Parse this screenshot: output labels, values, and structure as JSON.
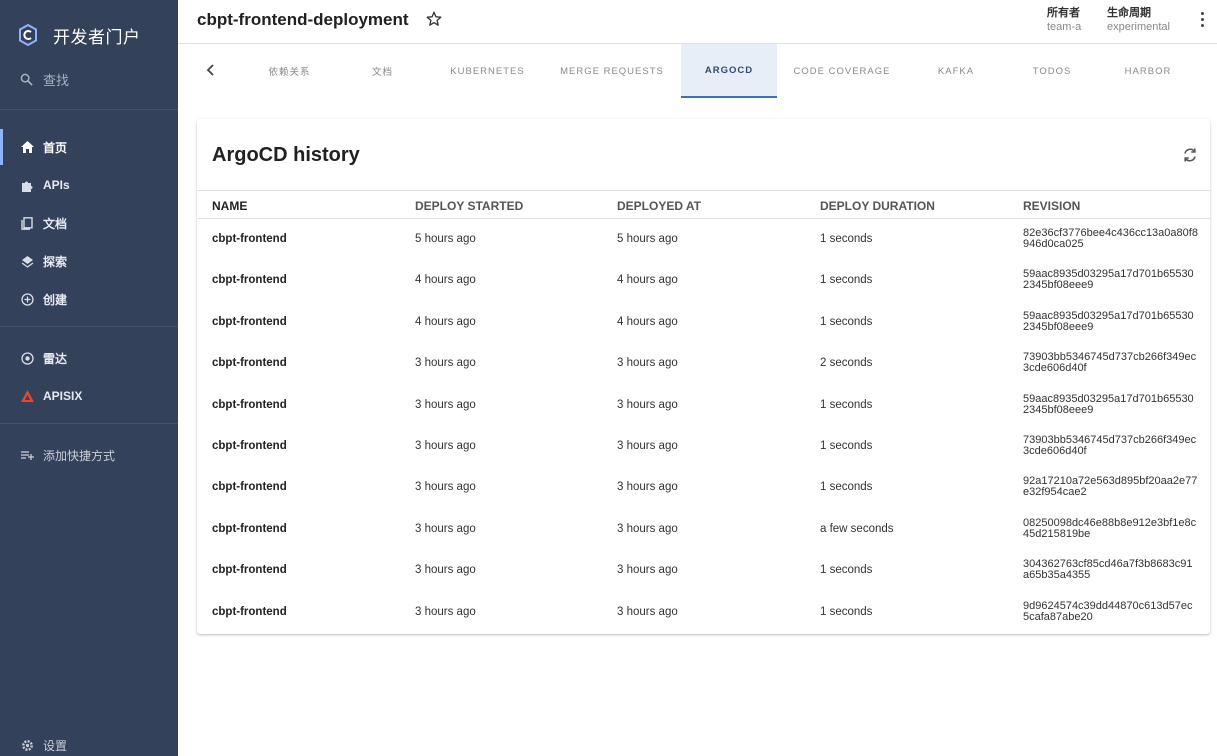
{
  "sidebar": {
    "brand": "开发者门户",
    "search_label": "查找",
    "items": [
      {
        "label": "首页",
        "icon": "home-icon"
      },
      {
        "label": "APIs",
        "icon": "puzzle-icon"
      },
      {
        "label": "文档",
        "icon": "docs-icon"
      },
      {
        "label": "探索",
        "icon": "layers-icon"
      },
      {
        "label": "创建",
        "icon": "add-circle-icon"
      },
      {
        "label": "雷达",
        "icon": "radar-icon"
      },
      {
        "label": "APISIX",
        "icon": "apisix-icon"
      },
      {
        "label": "添加快捷方式",
        "icon": "playlist-add-icon"
      },
      {
        "label": "设置",
        "icon": "gear-icon"
      }
    ]
  },
  "header": {
    "title": "cbpt-frontend-deployment",
    "owner_label": "所有者",
    "owner_value": "team-a",
    "lifecycle_label": "生命周期",
    "lifecycle_value": "experimental"
  },
  "tabs": [
    "依赖关系",
    "文档",
    "Kubernetes",
    "Merge Requests",
    "ArgoCD",
    "Code Coverage",
    "Kafka",
    "Todos",
    "Harbor"
  ],
  "active_tab": "ArgoCD",
  "card": {
    "title": "ArgoCD history",
    "columns": [
      "Name",
      "Deploy Started",
      "Deployed At",
      "Deploy Duration",
      "Revision"
    ],
    "rows": [
      {
        "name": "cbpt-frontend",
        "started": "5 hours ago",
        "deployed": "5 hours ago",
        "duration": "1 seconds",
        "revision": "82e36cf3776bee4c436cc13a0a80f8946d0ca025"
      },
      {
        "name": "cbpt-frontend",
        "started": "4 hours ago",
        "deployed": "4 hours ago",
        "duration": "1 seconds",
        "revision": "59aac8935d03295a17d701b655302345bf08eee9"
      },
      {
        "name": "cbpt-frontend",
        "started": "4 hours ago",
        "deployed": "4 hours ago",
        "duration": "1 seconds",
        "revision": "59aac8935d03295a17d701b655302345bf08eee9"
      },
      {
        "name": "cbpt-frontend",
        "started": "3 hours ago",
        "deployed": "3 hours ago",
        "duration": "2 seconds",
        "revision": "73903bb5346745d737cb266f349ec3cde606d40f"
      },
      {
        "name": "cbpt-frontend",
        "started": "3 hours ago",
        "deployed": "3 hours ago",
        "duration": "1 seconds",
        "revision": "59aac8935d03295a17d701b655302345bf08eee9"
      },
      {
        "name": "cbpt-frontend",
        "started": "3 hours ago",
        "deployed": "3 hours ago",
        "duration": "1 seconds",
        "revision": "73903bb5346745d737cb266f349ec3cde606d40f"
      },
      {
        "name": "cbpt-frontend",
        "started": "3 hours ago",
        "deployed": "3 hours ago",
        "duration": "1 seconds",
        "revision": "92a17210a72e563d895bf20aa2e77e32f954cae2"
      },
      {
        "name": "cbpt-frontend",
        "started": "3 hours ago",
        "deployed": "3 hours ago",
        "duration": "a few seconds",
        "revision": "08250098dc46e88b8e912e3bf1e8c45d215819be"
      },
      {
        "name": "cbpt-frontend",
        "started": "3 hours ago",
        "deployed": "3 hours ago",
        "duration": "1 seconds",
        "revision": "304362763cf85cd46a7f3b8683c91a65b35a4355"
      },
      {
        "name": "cbpt-frontend",
        "started": "3 hours ago",
        "deployed": "3 hours ago",
        "duration": "1 seconds",
        "revision": "9d9624574c39dd44870c613d57ec5cafa87abe20"
      }
    ]
  },
  "colors": {
    "sidebar_bg": "#34415a",
    "active_tab_bg": "#e8eef7",
    "active_tab_indicator": "#3f6fb5"
  }
}
